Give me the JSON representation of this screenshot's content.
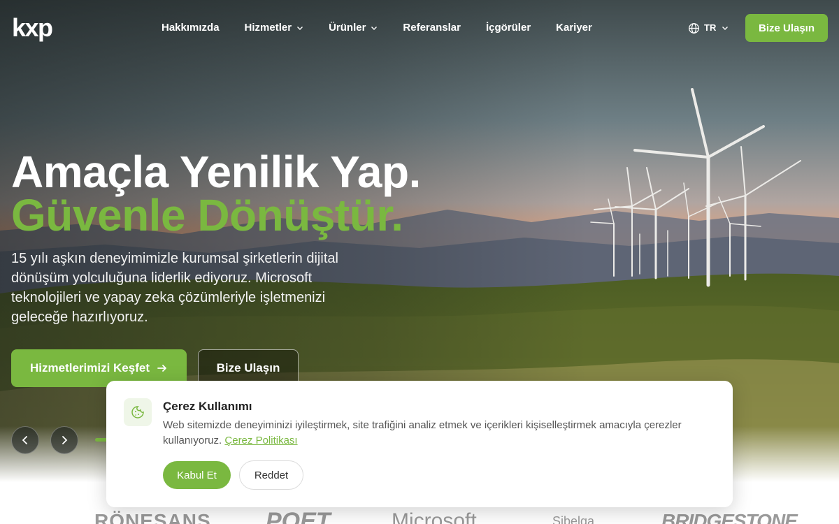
{
  "nav": {
    "logo": "kxp",
    "items": [
      {
        "label": "Hakkımızda",
        "has_dropdown": false
      },
      {
        "label": "Hizmetler",
        "has_dropdown": true
      },
      {
        "label": "Ürünler",
        "has_dropdown": true
      },
      {
        "label": "Referanslar",
        "has_dropdown": false
      },
      {
        "label": "İçgörüler",
        "has_dropdown": false
      },
      {
        "label": "Kariyer",
        "has_dropdown": false
      }
    ],
    "language": "TR",
    "cta_label": "Bize Ulaşın"
  },
  "hero": {
    "headline_line1": "Amaçla Yenilik Yap.",
    "headline_line2": "Güvenle Dönüştür.",
    "description": "15 yılı aşkın deneyimimizle kurumsal şirketlerin dijital dönüşüm yolculuğuna liderlik ediyoruz. Microsoft teknolojileri ve yapay zeka çözümleriyle işletmenizi geleceğe hazırlıyoruz.",
    "primary_button": "Hizmetlerimizi Keşfet",
    "secondary_button": "Bize Ulaşın"
  },
  "cookie": {
    "title": "Çerez Kullanımı",
    "text": "Web sitemizde deneyiminizi iyileştirmek, site trafiğini analiz etmek ve içerikleri kişiselleştirmek amacıyla çerezler kullanıyoruz.",
    "link_label": "Çerez Politikası",
    "accept_label": "Kabul Et",
    "reject_label": "Reddet"
  },
  "client_logos": [
    "RÖNESANS",
    "POET",
    "Microsoft",
    "Sibelga",
    "BRIDGESTONE"
  ],
  "colors": {
    "accent": "#7ab840",
    "text_dark": "#222222",
    "text_muted": "#555555"
  }
}
